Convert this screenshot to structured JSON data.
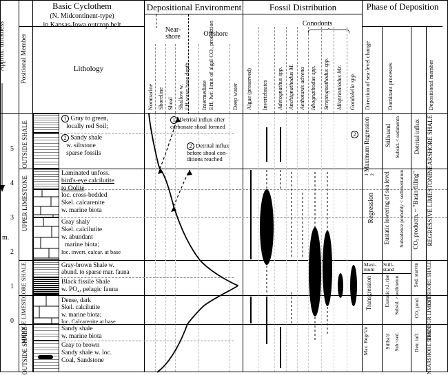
{
  "diagram": {
    "title_basic": "Basic Cyclothem",
    "title_sub1": "(N. Midcontinent-type)",
    "title_sub2": "in Kansas-Iowa outcrop belt",
    "header_depenv": "Depositional Environment",
    "header_fossil": "Fossil  Distribution",
    "header_phase": "Phase of Deposition",
    "approx_thickness": "Approx. thickness",
    "scale_m": "m.",
    "sub_positional": "Positional Member",
    "sub_lithology": "Lithology",
    "depenv": {
      "nearshore": "Near-shore",
      "offshore": "Offshore",
      "nonmarine": "Nonmarine",
      "shoreline": "Shoreline",
      "shoal": "Shoal",
      "shallow_w": "Shallow w.",
      "eff_wave": "Eff.wave base depth",
      "intermed": "Intermediate",
      "eff_lwr": "Eff. lwr. limit of algal CO₃ production",
      "deep_water": "Deep water"
    },
    "fossil": {
      "conodonts": "Conodonts",
      "algae": "Algae (preserved)",
      "inverts": "Invertebrates",
      "adeto": "Adetognathus spp.",
      "anchi": "Anchignathodus M.",
      "aetho": "Aethotaxis advena",
      "idiog": "Idiognathodus spp.",
      "strepto": "Streptognathodus spp.",
      "idiop": "Idioprioniodus Mx.",
      "gond": "Gondolella spp."
    },
    "phase": {
      "direction": "Direction of sea-level change",
      "dominant": "Dominant processes",
      "dep_member": "Depositional member",
      "max_reg": "Maximum Regression",
      "stillstand": "Stillstand",
      "subsid_lt": "Subsid. < sedimentn",
      "detrital_infl": "Detrital influx",
      "nearshore_shale": "NEARSHORE SHALE",
      "regression": "Regression",
      "eustatic_low": "Eustatic lowering of sea level",
      "subsid_prob": "Subsidence probably < sedimentation",
      "co3_basin": "CO₃ productn. ~ \"Basin filling\"",
      "regressive_ls": "REGRESSIVE  LIMESTONE",
      "maximum": "Maxi-mum",
      "stillstand2": "Still-stand",
      "sed_starvn": "Sed. starvtn",
      "offshore_shale": "OFFSHORE SHALE",
      "transgression": "Transgression",
      "eustatic_rise": "Eustatic s.l. rise",
      "subsid_gt": "Subsid. > sedimentn.",
      "co3_prod": "CO₃ prod.",
      "transgr_limest": "TRANSGR LIMEST.",
      "max_regr": "Max. Regr's'n",
      "stillstand3": "Stillst'd",
      "sub_sed": "Sub.<sed.",
      "detr_infl": "Detr. infl.",
      "nearshore_sh": "NEARSHORE SHALE"
    },
    "positional": {
      "outside_shale_top": "OUTSIDE SHALE",
      "upper_limestone": "UPPER  LIMESTONE",
      "core_shale": "CORE SHALE",
      "middle_limest": "MIDDLE LIMEST.",
      "outside_shale_bot": "OUTSIDE SHALE"
    },
    "lithology": {
      "l1a": "Gray to green,",
      "l1b": "locally red Soil;",
      "l2a": "Sandy shale",
      "l2b": "w. siltstone",
      "l2c": "sparse fossils",
      "l3a": "Laminated unfoss.",
      "l3b": "bird's-eye calcilutite",
      "l3c": "to Oolite",
      "l4a": "loc. cross-bedded",
      "l4b": "Skel. calcarenite",
      "l4c": "w. marine biota",
      "l5a": "Gray shaly",
      "l5b": "Skel. calcilutite",
      "l5c": "w. abundant",
      "l5d": "marine biota;",
      "l5e": "loc. invert. calcar. at base",
      "l6a": "Gray-brown Shale w.",
      "l6b": "abund. to sparse mar. fauna",
      "l7a": "Black fissile Shale",
      "l7b": "w. PO₄, pelagic fauna",
      "l8a": "Dense, dark",
      "l8b": "Skel. calcilutite",
      "l8c": "w. marine biota;",
      "l8d": "loc. Calcarenite at base",
      "l9a": "Sandy shale",
      "l9b": "w. marine biota",
      "l10a": "Gray to brown",
      "l10b": "Sandy shale w. loc.",
      "l10c": "Coal, Sandstone"
    },
    "notes": {
      "n1": "Detrital influx after carbonate shoal formed",
      "n2": "Detrital influx before shoal con-ditions reached"
    },
    "scale": [
      "0",
      "1",
      "2",
      "3",
      "4",
      "5"
    ]
  }
}
